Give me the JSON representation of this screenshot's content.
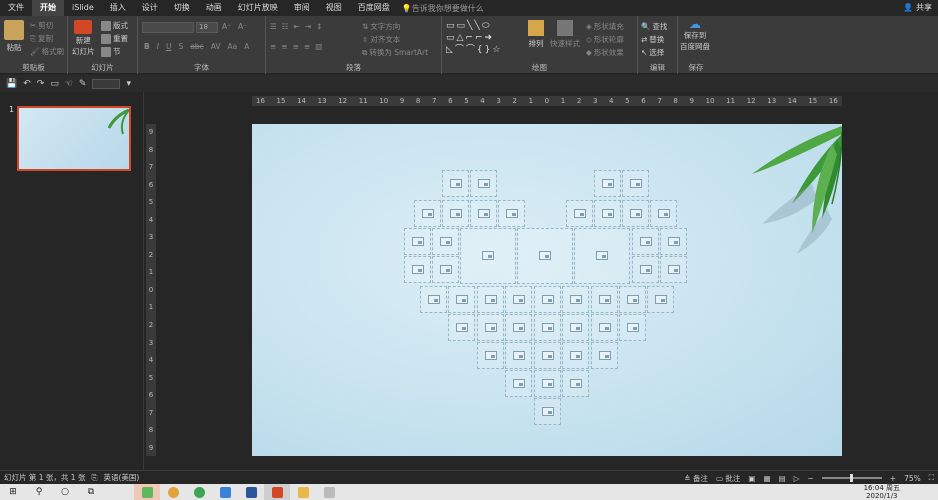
{
  "menu": {
    "tabs": [
      "文件",
      "开始",
      "iSlide",
      "插入",
      "设计",
      "切换",
      "动画",
      "幻灯片放映",
      "审阅",
      "视图",
      "百度网盘"
    ],
    "tell_me": "告诉我你想要做什么",
    "share": "共享"
  },
  "ribbon": {
    "clipboard": {
      "paste": "粘贴",
      "cut": "剪切",
      "copy": "复制",
      "format_painter": "格式刷",
      "label": "剪贴板"
    },
    "slides": {
      "new_slide": "新建",
      "new_slide_2": "幻灯片",
      "layout": "版式",
      "reset": "重置",
      "section": "节",
      "label": "幻灯片"
    },
    "font": {
      "size": "18",
      "label": "字体"
    },
    "paragraph": {
      "text_direction": "文字方向",
      "align_text": "对齐文本",
      "smartart": "转换为 SmartArt",
      "label": "段落"
    },
    "drawing": {
      "arrange": "排列",
      "quick_styles": "快速样式",
      "shape_fill": "形状填充",
      "shape_outline": "形状轮廓",
      "shape_effects": "形状效果",
      "label": "绘图"
    },
    "editing": {
      "find": "查找",
      "replace": "替换",
      "select": "选择",
      "label": "编辑"
    },
    "save": {
      "line1": "保存到",
      "line2": "百度网盘",
      "label": "保存"
    }
  },
  "thumbs": {
    "number": "1"
  },
  "ruler": {
    "h": [
      "16",
      "15",
      "14",
      "13",
      "12",
      "11",
      "10",
      "9",
      "8",
      "7",
      "6",
      "5",
      "4",
      "3",
      "2",
      "1",
      "0",
      "1",
      "2",
      "3",
      "4",
      "5",
      "6",
      "7",
      "8",
      "9",
      "10",
      "11",
      "12",
      "13",
      "14",
      "15",
      "16"
    ],
    "v": [
      "9",
      "8",
      "7",
      "6",
      "5",
      "4",
      "3",
      "2",
      "1",
      "0",
      "1",
      "2",
      "3",
      "4",
      "5",
      "6",
      "7",
      "8",
      "9"
    ]
  },
  "status": {
    "slide_info": "幻灯片 第 1 张，共 1 张",
    "language": "英语(美国)",
    "notes": "备注",
    "comments": "批注",
    "zoom": "75%"
  },
  "taskbar": {
    "time": "16:04 周五",
    "date": "2020/1/3"
  },
  "colors": {
    "accent": "#d24726",
    "slide_bg": "#c6e2ef",
    "leaf": "#3d9a3a"
  }
}
